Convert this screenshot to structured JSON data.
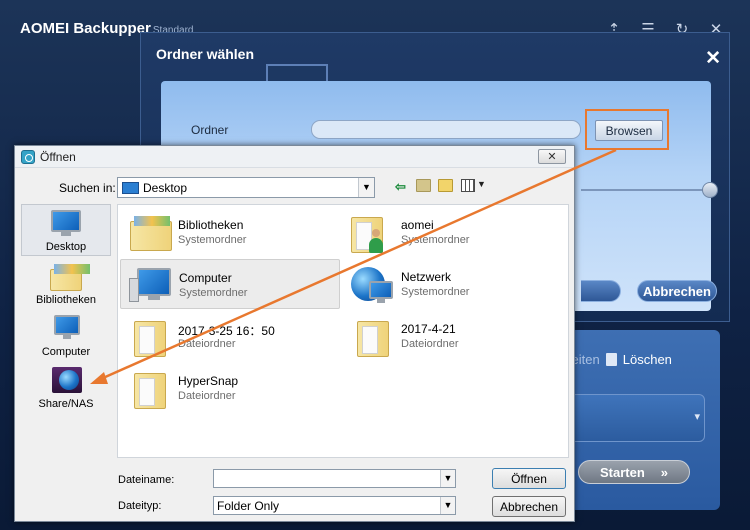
{
  "aomei": {
    "app_title": "AOMEI Backupper",
    "edition": "Standard",
    "window_controls": [
      "upgrade-icon",
      "menu-icon",
      "refresh-icon",
      "close-icon"
    ],
    "delete_partial": "rbeiten",
    "delete_label": "Löschen",
    "start_label": "Starten",
    "start_chevron": "»"
  },
  "folder_dialog": {
    "title": "Ordner wählen",
    "close_glyph": "✕",
    "folder_label": "Ordner",
    "folder_value": "",
    "browse_label": "Browsen",
    "cancel_label": "Abbrechen"
  },
  "open_dialog": {
    "title": "Öffnen",
    "close_glyph": "✕",
    "look_in_label": "Suchen in:",
    "look_in_value": "Desktop",
    "places": [
      {
        "label": "Desktop",
        "icon": "desktop-icon"
      },
      {
        "label": "Bibliotheken",
        "icon": "libraries-icon"
      },
      {
        "label": "Computer",
        "icon": "computer-icon"
      },
      {
        "label": "Share/NAS",
        "icon": "share-nas-icon"
      }
    ],
    "items": [
      {
        "name": "Bibliotheken",
        "type": "Systemordner"
      },
      {
        "name": "aomei",
        "type": "Systemordner"
      },
      {
        "name": "Computer",
        "type": "Systemordner"
      },
      {
        "name": "Netzwerk",
        "type": "Systemordner"
      },
      {
        "name": "2017-3-25 16：50",
        "type": "Dateiordner"
      },
      {
        "name": "2017-4-21",
        "type": "Dateiordner"
      },
      {
        "name": "HyperSnap",
        "type": "Dateiordner"
      }
    ],
    "filename_label": "Dateiname:",
    "filename_value": "",
    "filetype_label": "Dateityp:",
    "filetype_value": "Folder Only",
    "open_button": "Öffnen",
    "cancel_button": "Abbrechen"
  },
  "colors": {
    "highlight": "#e8782f",
    "dialog_blue": "#1f3a66"
  }
}
